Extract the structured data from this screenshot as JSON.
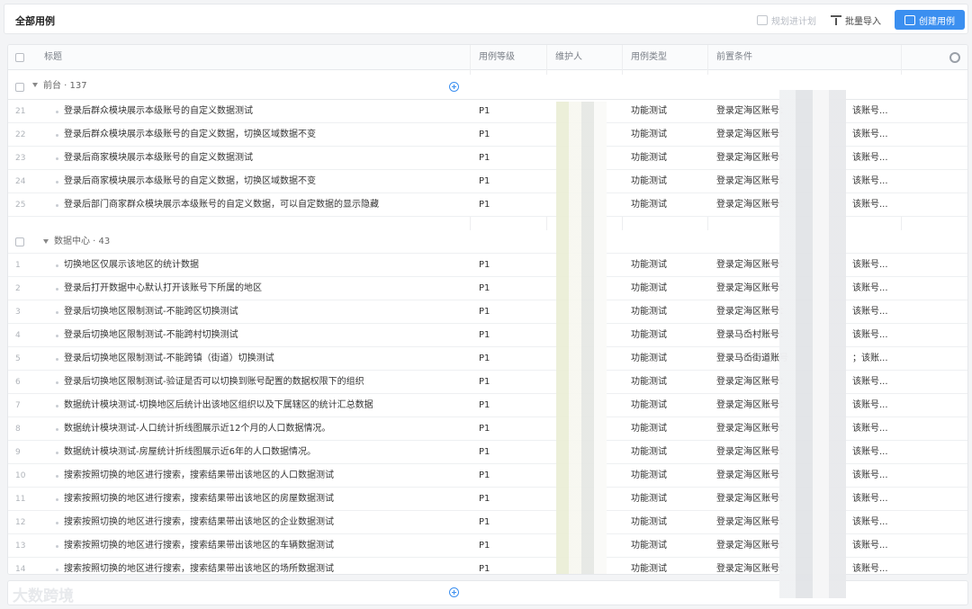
{
  "header": {
    "title": "全部用例",
    "plan_label": "规划进计划",
    "import_label": "批量导入",
    "create_label": "创建用例"
  },
  "columns": {
    "title": "标题",
    "level": "用例等级",
    "maintainer": "维护人",
    "type": "用例类型",
    "precondition": "前置条件"
  },
  "groups": [
    {
      "label": "前台 · 137"
    },
    {
      "label": "数据中心 · 43"
    }
  ],
  "group1_rows": [
    {
      "num": "21",
      "title": "登录后群众模块展示本级账号的自定义数据测试",
      "level": "P1",
      "type": "功能测试",
      "pre": "登录定海区账号：",
      "pre_tail": "该账号..."
    },
    {
      "num": "22",
      "title": "登录后群众模块展示本级账号的自定义数据，切换区域数据不变",
      "level": "P1",
      "type": "功能测试",
      "pre": "登录定海区账号：",
      "pre_tail": "该账号..."
    },
    {
      "num": "23",
      "title": "登录后商家模块展示本级账号的自定义数据测试",
      "level": "P1",
      "type": "功能测试",
      "pre": "登录定海区账号：",
      "pre_tail": "该账号..."
    },
    {
      "num": "24",
      "title": "登录后商家模块展示本级账号的自定义数据，切换区域数据不变",
      "level": "P1",
      "type": "功能测试",
      "pre": "登录定海区账号：",
      "pre_tail": "该账号..."
    },
    {
      "num": "25",
      "title": "登录后部门商家群众模块展示本级账号的自定义数据，可以自定数据的显示隐藏",
      "level": "P1",
      "type": "功能测试",
      "pre": "登录定海区账号：",
      "pre_tail": "该账号..."
    }
  ],
  "group2_rows": [
    {
      "num": "1",
      "title": "切换地区仅展示该地区的统计数据",
      "level": "P1",
      "type": "功能测试",
      "pre": "登录定海区账号：",
      "pre_tail": "该账号..."
    },
    {
      "num": "2",
      "title": "登录后打开数据中心默认打开该账号下所属的地区",
      "level": "P1",
      "type": "功能测试",
      "pre": "登录定海区账号：",
      "pre_tail": "该账号..."
    },
    {
      "num": "3",
      "title": "登录后切换地区限制测试-不能跨区切换测试",
      "level": "P1",
      "type": "功能测试",
      "pre": "登录定海区账号：",
      "pre_tail": "该账号..."
    },
    {
      "num": "4",
      "title": "登录后切换地区限制测试-不能跨村切换测试",
      "level": "P1",
      "type": "功能测试",
      "pre": "登录马岙村账号：",
      "pre_tail": "该账号..."
    },
    {
      "num": "5",
      "title": "登录后切换地区限制测试-不能跨镇（街道）切换测试",
      "level": "P1",
      "type": "功能测试",
      "pre": "登录马岙街道账号",
      "pre_tail": "；该账..."
    },
    {
      "num": "6",
      "title": "登录后切换地区限制测试-验证是否可以切换到账号配置的数据权限下的组织",
      "level": "P1",
      "type": "功能测试",
      "pre": "登录定海区账号：",
      "pre_tail": "该账号..."
    },
    {
      "num": "7",
      "title": "数据统计模块测试-切换地区后统计出该地区组织以及下属辖区的统计汇总数据",
      "level": "P1",
      "type": "功能测试",
      "pre": "登录定海区账号：",
      "pre_tail": "该账号..."
    },
    {
      "num": "8",
      "title": "数据统计模块测试-人口统计折线图展示近12个月的人口数据情况。",
      "level": "P1",
      "type": "功能测试",
      "pre": "登录定海区账号：",
      "pre_tail": "该账号..."
    },
    {
      "num": "9",
      "title": "数据统计模块测试-房屋统计折线图展示近6年的人口数据情况。",
      "level": "P1",
      "type": "功能测试",
      "pre": "登录定海区账号：",
      "pre_tail": "该账号..."
    },
    {
      "num": "10",
      "title": "搜索按照切换的地区进行搜索，搜索结果带出该地区的人口数据测试",
      "level": "P1",
      "type": "功能测试",
      "pre": "登录定海区账号：",
      "pre_tail": "该账号..."
    },
    {
      "num": "11",
      "title": "搜索按照切换的地区进行搜索，搜索结果带出该地区的房屋数据测试",
      "level": "P1",
      "type": "功能测试",
      "pre": "登录定海区账号：",
      "pre_tail": "该账号..."
    },
    {
      "num": "12",
      "title": "搜索按照切换的地区进行搜索，搜索结果带出该地区的企业数据测试",
      "level": "P1",
      "type": "功能测试",
      "pre": "登录定海区账号：",
      "pre_tail": "该账号..."
    },
    {
      "num": "13",
      "title": "搜索按照切换的地区进行搜索，搜索结果带出该地区的车辆数据测试",
      "level": "P1",
      "type": "功能测试",
      "pre": "登录定海区账号：",
      "pre_tail": "该账号..."
    },
    {
      "num": "14",
      "title": "搜索按照切换的地区进行搜索，搜索结果带出该地区的场所数据测试",
      "level": "P1",
      "type": "功能测试",
      "pre": "登录定海区账号：",
      "pre_tail": "该账号..."
    }
  ],
  "watermark": "大数跨境"
}
